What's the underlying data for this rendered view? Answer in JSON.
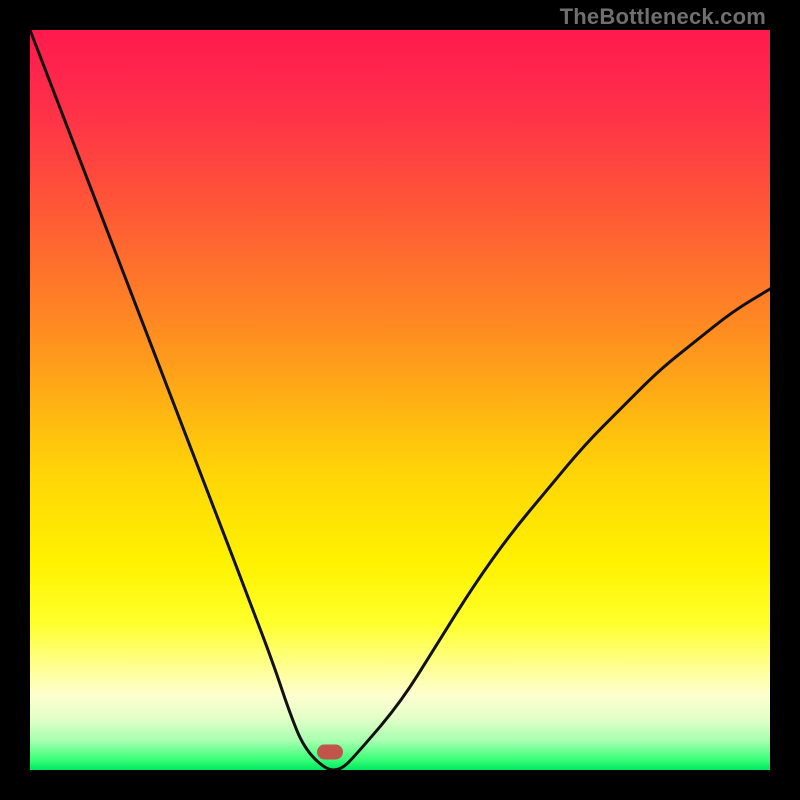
{
  "watermark": "TheBottleneck.com",
  "chart_data": {
    "type": "line",
    "title": "",
    "xlabel": "",
    "ylabel": "",
    "xlim": [
      0,
      100
    ],
    "ylim": [
      0,
      100
    ],
    "x": [
      0,
      5,
      10,
      15,
      20,
      25,
      30,
      33,
      35,
      37,
      40,
      42,
      44,
      50,
      55,
      60,
      65,
      70,
      75,
      80,
      85,
      90,
      95,
      100
    ],
    "values": [
      100,
      87,
      74,
      61,
      48,
      35,
      22,
      14,
      8,
      3,
      0,
      0,
      2,
      9,
      17,
      25,
      32,
      38,
      44,
      49,
      54,
      58,
      62,
      65
    ],
    "series": [
      {
        "name": "bottleneck-curve",
        "type": "line"
      }
    ],
    "marker": {
      "x_fraction": 0.405,
      "y_fraction": 0.975,
      "color": "#c1544b"
    },
    "gradient_stops": [
      {
        "offset": 0.0,
        "color": "#ff1a4d"
      },
      {
        "offset": 0.1,
        "color": "#ff2e4a"
      },
      {
        "offset": 0.2,
        "color": "#ff4b3c"
      },
      {
        "offset": 0.3,
        "color": "#ff6a2f"
      },
      {
        "offset": 0.4,
        "color": "#ff8a22"
      },
      {
        "offset": 0.5,
        "color": "#ffb014"
      },
      {
        "offset": 0.6,
        "color": "#ffd507"
      },
      {
        "offset": 0.72,
        "color": "#fff200"
      },
      {
        "offset": 0.8,
        "color": "#ffff2a"
      },
      {
        "offset": 0.86,
        "color": "#ffff90"
      },
      {
        "offset": 0.9,
        "color": "#fdffd0"
      },
      {
        "offset": 0.93,
        "color": "#e3ffc8"
      },
      {
        "offset": 0.96,
        "color": "#a8ffb0"
      },
      {
        "offset": 0.985,
        "color": "#3fff7a"
      },
      {
        "offset": 1.0,
        "color": "#00e860"
      }
    ],
    "curve_color": "#111111",
    "curve_width": 3
  }
}
